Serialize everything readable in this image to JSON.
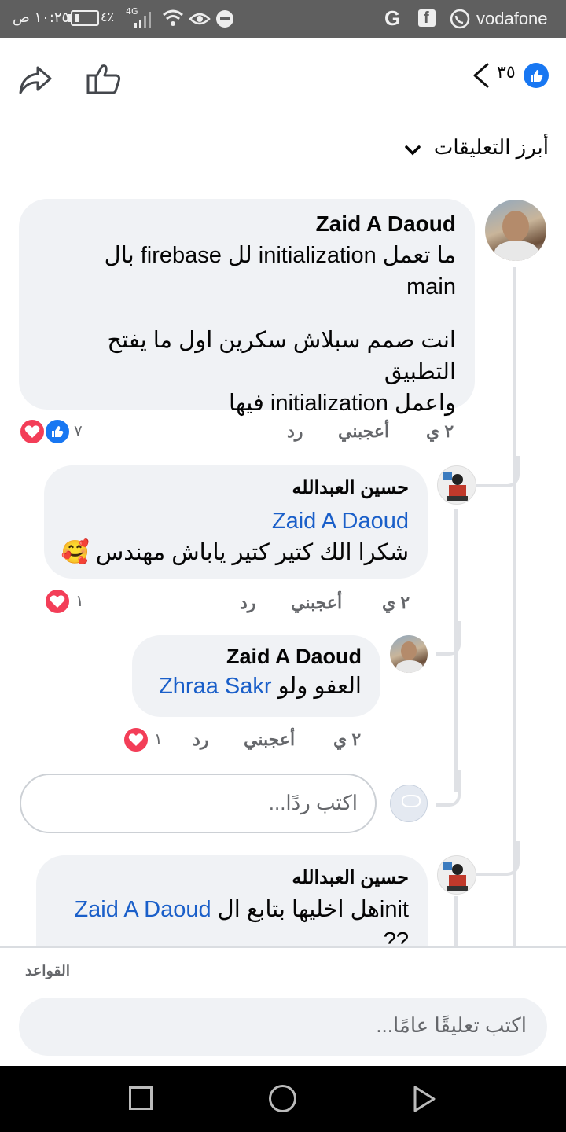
{
  "status_bar": {
    "time": "١٠:٢٥ ص",
    "battery": "٤٪",
    "network": "4G",
    "carrier": "vodafone"
  },
  "top_bar": {
    "reactions_count": "٣٥"
  },
  "sort": {
    "label": "أبرز التعليقات"
  },
  "comments": [
    {
      "author": "Zaid A Daoud",
      "text_line1": "ما تعمل initialization لل firebase بال",
      "text_line2": "main",
      "text_line3": "انت صمم سبلاش سكرين اول ما يفتح التطبيق",
      "text_line4": "واعمل initialization فيها",
      "time": "٢ ي",
      "like": "أعجبني",
      "reply": "رد",
      "reaction_count": "٧"
    },
    {
      "author": "حسين العبدالله",
      "mention": "Zaid A Daoud",
      "text": "شكرا الك كتير كتير ياباش مهندس",
      "emoji": "🥰",
      "time": "٢ ي",
      "like": "أعجبني",
      "reply": "رد",
      "reaction_count": "١"
    },
    {
      "author": "Zaid A Daoud",
      "text": "العفو ولو",
      "mention": "Zhraa Sakr",
      "time": "٢ ي",
      "like": "أعجبني",
      "reply": "رد",
      "reaction_count": "١"
    },
    {
      "author": "حسين العبدالله",
      "text": "هل اخليها بتابع ال",
      "text_inline": "init",
      "mention": "Zaid A Daoud",
      "text_line2": "??"
    }
  ],
  "reply_input": {
    "placeholder": "اكتب ردًا..."
  },
  "footer": {
    "rules_link": "القواعد",
    "comment_placeholder": "اكتب تعليقًا عامًا..."
  },
  "colors": {
    "like_blue": "#1877f2",
    "heart_red": "#f33e58",
    "mention_blue": "#1a5fc9",
    "bubble_bg": "#f0f2f5"
  }
}
